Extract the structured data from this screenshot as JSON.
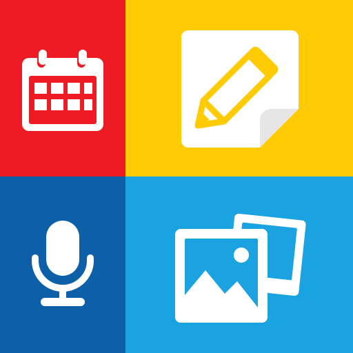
{
  "colors": {
    "calendar_tile": "#ED1C24",
    "notes_tile": "#FFCB05",
    "voice_tile": "#0D5FA8",
    "photos_tile": "#1AA3E0",
    "icon_fill": "#FFFFFF",
    "photo_border": "#FFFFFF"
  },
  "tiles": [
    {
      "id": "calendar",
      "icon": "calendar-icon"
    },
    {
      "id": "notes",
      "icon": "note-pencil-icon"
    },
    {
      "id": "voice",
      "icon": "microphone-icon"
    },
    {
      "id": "photos",
      "icon": "photo-gallery-icon"
    }
  ]
}
